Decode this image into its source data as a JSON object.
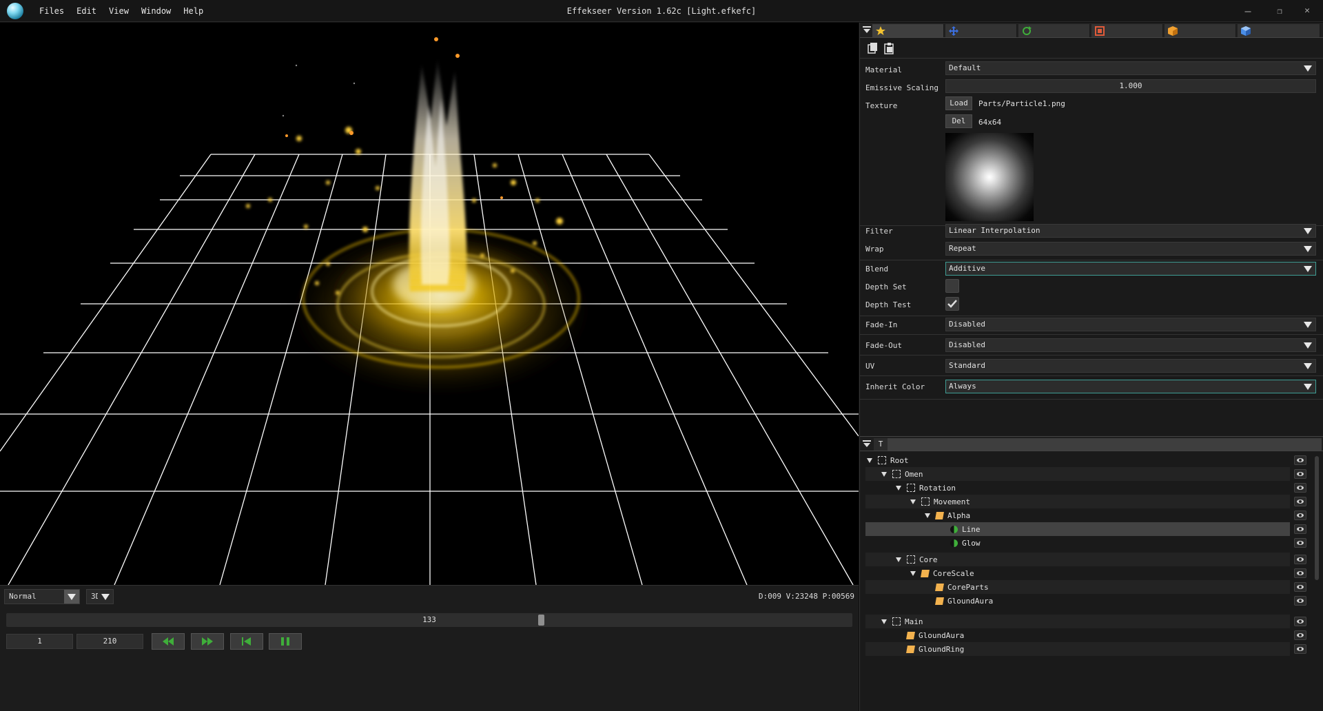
{
  "window": {
    "title": "Effekseer Version 1.62c [Light.efkefc]",
    "menu": [
      "Files",
      "Edit",
      "View",
      "Window",
      "Help"
    ],
    "controls": {
      "minimize": "–",
      "restore": "❐",
      "close": "✕"
    }
  },
  "viewport": {
    "render_mode": "Normal",
    "view_mode": "3D",
    "stats": "D:009  V:23248  P:00569",
    "timeline": {
      "current": "133",
      "start": "1",
      "end": "210",
      "position_fraction": 0.633
    }
  },
  "playback_buttons": [
    "rewind-icon",
    "fast-forward-icon",
    "skip-to-start-icon",
    "pause-icon"
  ],
  "properties": {
    "tab_icons": [
      "star-icon",
      "move-icon",
      "rotate-icon",
      "scale-icon",
      "box-icon",
      "cube-icon"
    ],
    "material": {
      "label": "Material",
      "value": "Default"
    },
    "emissive": {
      "label": "Emissive Scaling",
      "value": "1.000"
    },
    "texture": {
      "label": "Texture",
      "load_label": "Load",
      "path": "Parts/Particle1.png",
      "del_label": "Del",
      "size": "64x64"
    },
    "filter": {
      "label": "Filter",
      "value": "Linear Interpolation"
    },
    "wrap": {
      "label": "Wrap",
      "value": "Repeat"
    },
    "blend": {
      "label": "Blend",
      "value": "Additive"
    },
    "depth_set": {
      "label": "Depth Set",
      "checked": false
    },
    "depth_test": {
      "label": "Depth Test",
      "checked": true
    },
    "fade_in": {
      "label": "Fade-In",
      "value": "Disabled"
    },
    "fade_out": {
      "label": "Fade-Out",
      "value": "Disabled"
    },
    "uv": {
      "label": "UV",
      "value": "Standard"
    },
    "inherit_color": {
      "label": "Inherit Color",
      "value": "Always"
    }
  },
  "node_tree": {
    "tab_label": "T",
    "nodes": [
      {
        "label": "Root",
        "icon": "group",
        "expanded": true
      },
      {
        "label": "Omen",
        "icon": "group",
        "expanded": true
      },
      {
        "label": "Rotation",
        "icon": "group",
        "expanded": true
      },
      {
        "label": "Movement",
        "icon": "group",
        "expanded": true
      },
      {
        "label": "Alpha",
        "icon": "sprite",
        "expanded": true
      },
      {
        "label": "Line",
        "icon": "ribbon",
        "selected": true
      },
      {
        "label": "Glow",
        "icon": "ribbon"
      },
      {
        "label": "Core",
        "icon": "group",
        "expanded": true
      },
      {
        "label": "CoreScale",
        "icon": "sprite",
        "expanded": true
      },
      {
        "label": "CoreParts",
        "icon": "sprite"
      },
      {
        "label": "GloundAura",
        "icon": "sprite"
      },
      {
        "label": "Main",
        "icon": "group",
        "expanded": true
      },
      {
        "label": "GloundAura",
        "icon": "sprite"
      },
      {
        "label": "GloundRing",
        "icon": "sprite"
      }
    ]
  },
  "colors": {
    "accent": "#3f9e95",
    "effect_core": "#fff4b0",
    "effect_glow": "#f5c400",
    "sprite_icon": "#f3b24e",
    "ribbon_icon": "#3fae3a",
    "grid": "#ffffff"
  }
}
